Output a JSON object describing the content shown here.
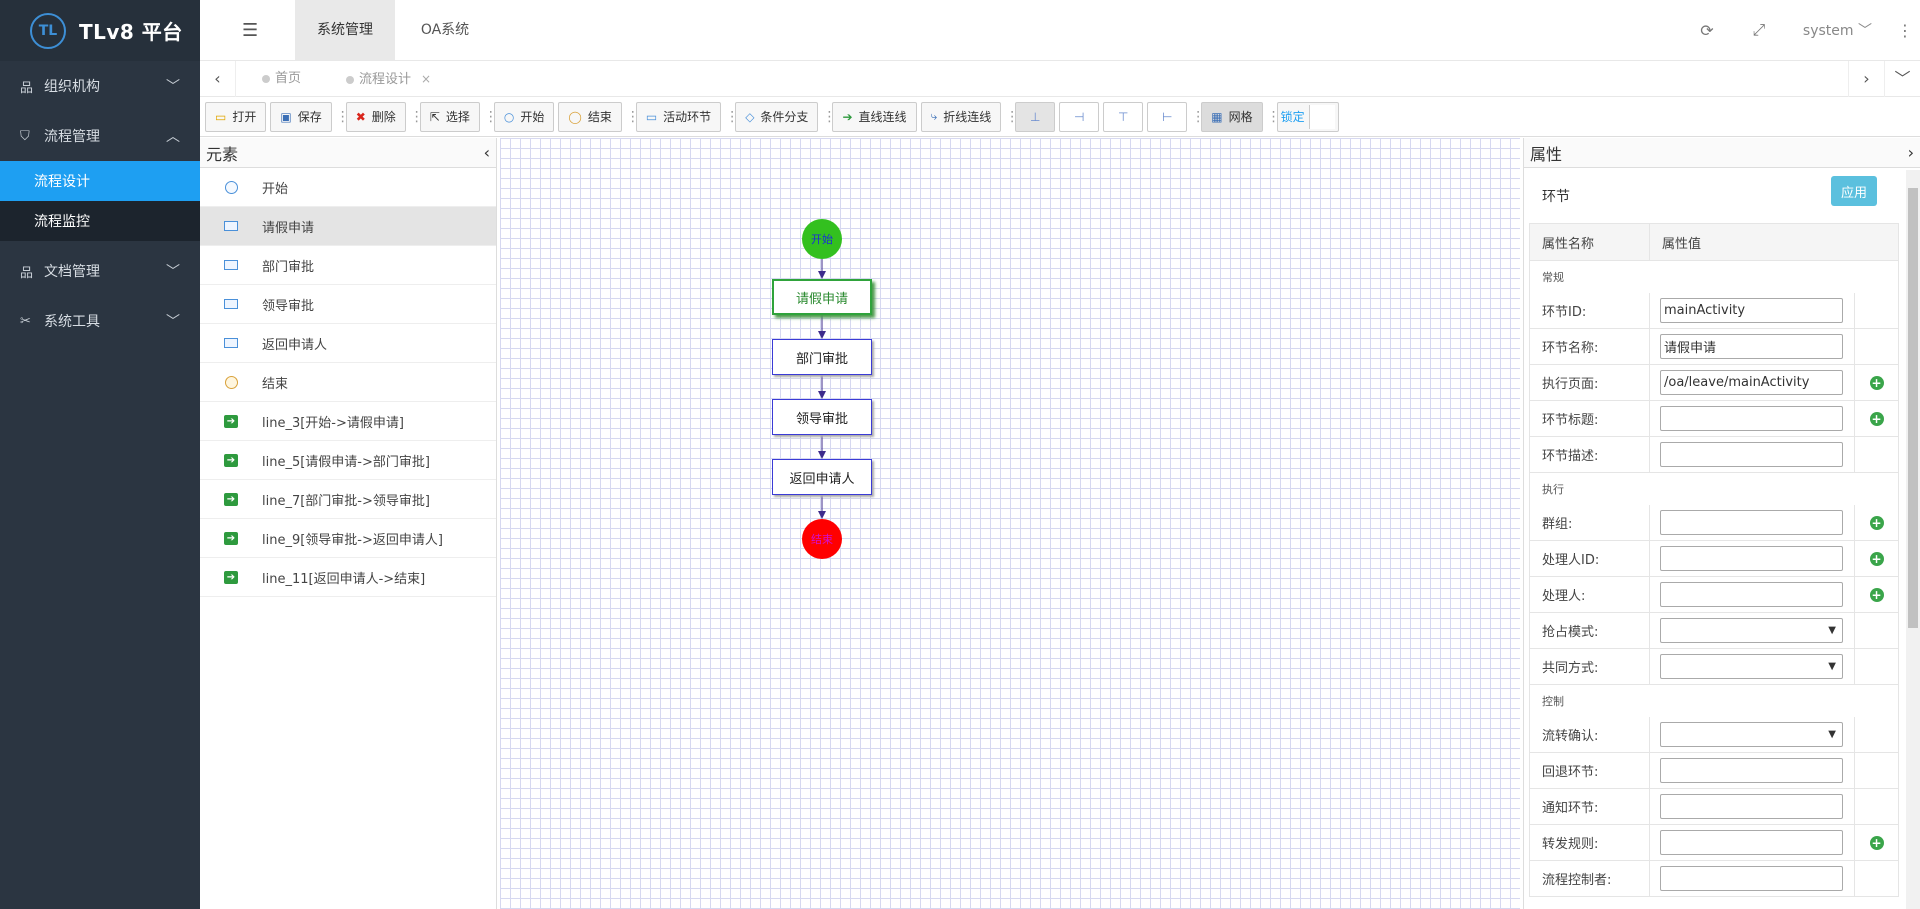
{
  "app": {
    "logo_text": "TL",
    "title": "TLv8 平台"
  },
  "sidebar": {
    "items": [
      {
        "label": "组织机构",
        "icon": "sitemap-icon"
      },
      {
        "label": "流程管理",
        "icon": "shield-icon",
        "expanded": true,
        "children": [
          {
            "label": "流程设计",
            "active": true
          },
          {
            "label": "流程监控"
          }
        ]
      },
      {
        "label": "文档管理",
        "icon": "sitemap-icon"
      },
      {
        "label": "系统工具",
        "icon": "tools-icon"
      }
    ]
  },
  "header": {
    "tabs": [
      {
        "label": "系统管理",
        "active": true
      },
      {
        "label": "OA系统"
      }
    ],
    "user": "system"
  },
  "page_tabs": [
    {
      "label": "首页"
    },
    {
      "label": "流程设计",
      "active": true,
      "close": "×"
    }
  ],
  "toolbar": {
    "open": "打开",
    "save": "保存",
    "delete": "删除",
    "select": "选择",
    "start": "开始",
    "end": "结束",
    "activity": "活动环节",
    "condition": "条件分支",
    "straight_line": "直线连线",
    "polyline": "折线连线",
    "grid": "网格",
    "lock": "锁定"
  },
  "elements_panel": {
    "title": "元素",
    "items": [
      {
        "type": "start",
        "label": "开始"
      },
      {
        "type": "activity",
        "label": "请假申请",
        "selected": true
      },
      {
        "type": "activity",
        "label": "部门审批"
      },
      {
        "type": "activity",
        "label": "领导审批"
      },
      {
        "type": "activity",
        "label": "返回申请人"
      },
      {
        "type": "end",
        "label": "结束"
      },
      {
        "type": "line",
        "label": "line_3[开始->请假申请]"
      },
      {
        "type": "line",
        "label": "line_5[请假申请->部门审批]"
      },
      {
        "type": "line",
        "label": "line_7[部门审批->领导审批]"
      },
      {
        "type": "line",
        "label": "line_9[领导审批->返回申请人]"
      },
      {
        "type": "line",
        "label": "line_11[返回申请人->结束]"
      }
    ]
  },
  "diagram": {
    "start": "开始",
    "activities": [
      "请假申请",
      "部门审批",
      "领导审批",
      "返回申请人"
    ],
    "end": "结束"
  },
  "properties": {
    "title": "属性",
    "node_type": "环节",
    "apply": "应用",
    "col_name": "属性名称",
    "col_value": "属性值",
    "groups": [
      {
        "name": "常规",
        "rows": [
          {
            "label": "环节ID:",
            "value": "mainActivity",
            "kind": "input"
          },
          {
            "label": "环节名称:",
            "value": "请假申请",
            "kind": "input"
          },
          {
            "label": "执行页面:",
            "value": "/oa/leave/mainActivity",
            "kind": "input",
            "plus": true
          },
          {
            "label": "环节标题:",
            "value": "",
            "kind": "input",
            "plus": true
          },
          {
            "label": "环节描述:",
            "value": "",
            "kind": "textarea"
          }
        ]
      },
      {
        "name": "执行",
        "rows": [
          {
            "label": "群组:",
            "value": "",
            "kind": "input",
            "plus": true
          },
          {
            "label": "处理人ID:",
            "value": "",
            "kind": "input",
            "plus": true
          },
          {
            "label": "处理人:",
            "value": "",
            "kind": "input",
            "plus": true
          },
          {
            "label": "抢占模式:",
            "value": "",
            "kind": "select"
          },
          {
            "label": "共同方式:",
            "value": "",
            "kind": "select"
          }
        ]
      },
      {
        "name": "控制",
        "rows": [
          {
            "label": "流转确认:",
            "value": "",
            "kind": "select"
          },
          {
            "label": "回退环节:",
            "value": "",
            "kind": "input"
          },
          {
            "label": "通知环节:",
            "value": "",
            "kind": "input"
          },
          {
            "label": "转发规则:",
            "value": "",
            "kind": "input",
            "plus": true
          },
          {
            "label": "流程控制者:",
            "value": "",
            "kind": "input"
          }
        ]
      }
    ]
  },
  "colors": {
    "sidebar_bg": "#2b3541",
    "accent": "#1e9ff2",
    "apply_btn": "#5bc0de"
  }
}
